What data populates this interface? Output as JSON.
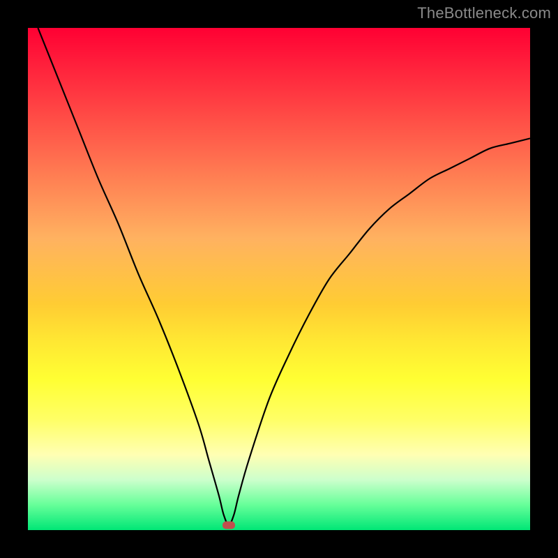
{
  "watermark": "TheBottleneck.com",
  "chart_data": {
    "type": "line",
    "title": "",
    "xlabel": "",
    "ylabel": "",
    "xlim": [
      0,
      100
    ],
    "ylim": [
      0,
      100
    ],
    "grid": false,
    "legend": false,
    "annotations": [],
    "curve": {
      "name": "bottleneck-curve",
      "color": "#000000",
      "x": [
        2,
        6,
        10,
        14,
        18,
        22,
        26,
        30,
        34,
        36,
        38,
        39,
        40,
        41,
        42,
        44,
        48,
        52,
        56,
        60,
        64,
        68,
        72,
        76,
        80,
        84,
        88,
        92,
        96,
        100
      ],
      "y": [
        100,
        90,
        80,
        70,
        61,
        51,
        42,
        32,
        21,
        14,
        7,
        3,
        1,
        3,
        7,
        14,
        26,
        35,
        43,
        50,
        55,
        60,
        64,
        67,
        70,
        72,
        74,
        76,
        77,
        78
      ]
    },
    "marker": {
      "x": 40,
      "y": 1,
      "color": "#c0504d"
    },
    "background_gradient": {
      "top": "#ff0033",
      "middle": "#ffff33",
      "bottom": "#00e676"
    }
  }
}
